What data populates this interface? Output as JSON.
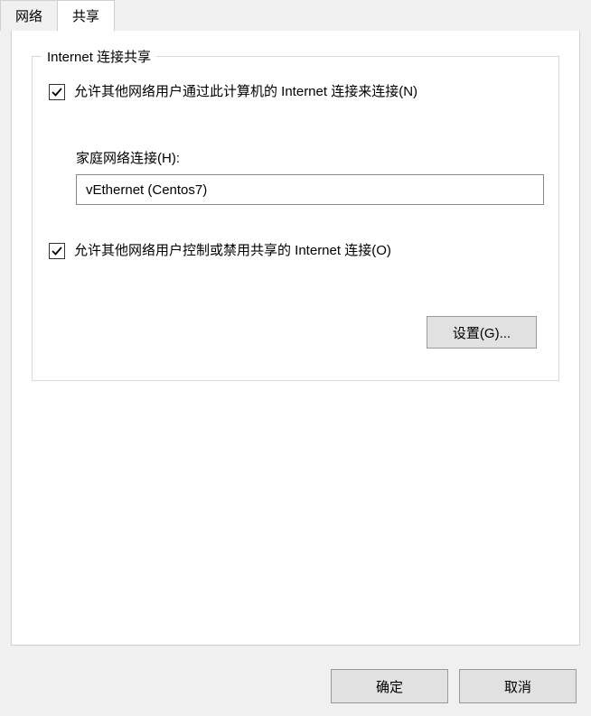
{
  "tabs": {
    "network": "网络",
    "sharing": "共享"
  },
  "groupbox": {
    "title": "Internet 连接共享"
  },
  "allow_connect": {
    "checked": true,
    "label": "允许其他网络用户通过此计算机的 Internet 连接来连接(N)"
  },
  "home_network": {
    "label": "家庭网络连接(H):",
    "value": "vEthernet (Centos7)"
  },
  "allow_control": {
    "checked": true,
    "label": "允许其他网络用户控制或禁用共享的 Internet 连接(O)"
  },
  "buttons": {
    "settings": "设置(G)...",
    "ok": "确定",
    "cancel": "取消"
  }
}
